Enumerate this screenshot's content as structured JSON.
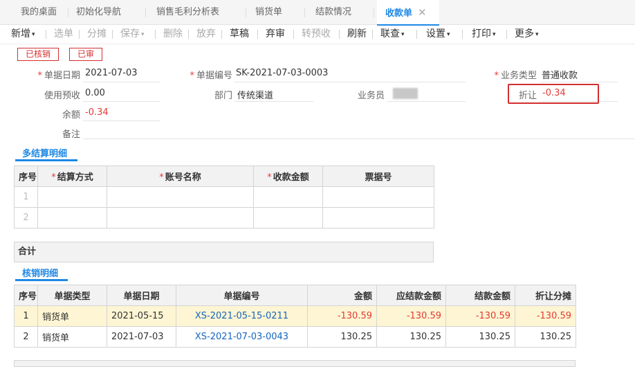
{
  "tabs": [
    {
      "label": "我的桌面"
    },
    {
      "label": "初始化导航"
    },
    {
      "label": "销售毛利分析表"
    },
    {
      "label": "销货单"
    },
    {
      "label": "结款情况"
    },
    {
      "label": "收款单",
      "close": "✕"
    }
  ],
  "toolbar": {
    "add": "新增",
    "select": "选单",
    "apportion": "分摊",
    "save": "保存",
    "delete": "删除",
    "discard": "放弃",
    "draft": "草稿",
    "abandon": "弃审",
    "to_prepaid": "转预收",
    "refresh": "刷新",
    "link_query": "联查",
    "settings": "设置",
    "print": "打印",
    "more": "更多",
    "caret": "▾"
  },
  "stamps": {
    "verified": "已核销",
    "audited": "已审"
  },
  "form": {
    "bill_date_label": "单据日期",
    "bill_date": "2021-07-03",
    "bill_no_label": "单据编号",
    "bill_no": "SK-2021-07-03-0003",
    "biz_type_label": "业务类型",
    "biz_type": "普通收款",
    "use_prepaid_label": "使用预收",
    "use_prepaid": "0.00",
    "dept_label": "部门",
    "dept": "传统渠道",
    "salesman_label": "业务员",
    "discount_label": "折让",
    "discount": "-0.34",
    "balance_label": "余额",
    "balance": "-0.34",
    "remark_label": "备注",
    "required_mark": "*"
  },
  "settle": {
    "title": "多结算明细",
    "headers": [
      "序号",
      "结算方式",
      "账号名称",
      "收款金额",
      "票据号"
    ],
    "rows": [
      "1",
      "2"
    ],
    "total_label": "合计"
  },
  "verify": {
    "title": "核销明细",
    "headers": [
      "序号",
      "单据类型",
      "单据日期",
      "单据编号",
      "金额",
      "应结款金额",
      "结款金额",
      "折让分摊"
    ],
    "rows": [
      {
        "no": "1",
        "type": "销货单",
        "date": "2021-05-15",
        "bill_no": "XS-2021-05-15-0211",
        "amount": "-130.59",
        "due": "-130.59",
        "paid": "-130.59",
        "discount": "-130.59"
      },
      {
        "no": "2",
        "type": "销货单",
        "date": "2021-07-03",
        "bill_no": "XS-2021-07-03-0043",
        "amount": "130.25",
        "due": "130.25",
        "paid": "130.25",
        "discount": "130.25"
      }
    ]
  },
  "colors": {
    "accent": "#1e88e5",
    "negative": "#e53935",
    "highlight_row": "#fdf5d3"
  }
}
